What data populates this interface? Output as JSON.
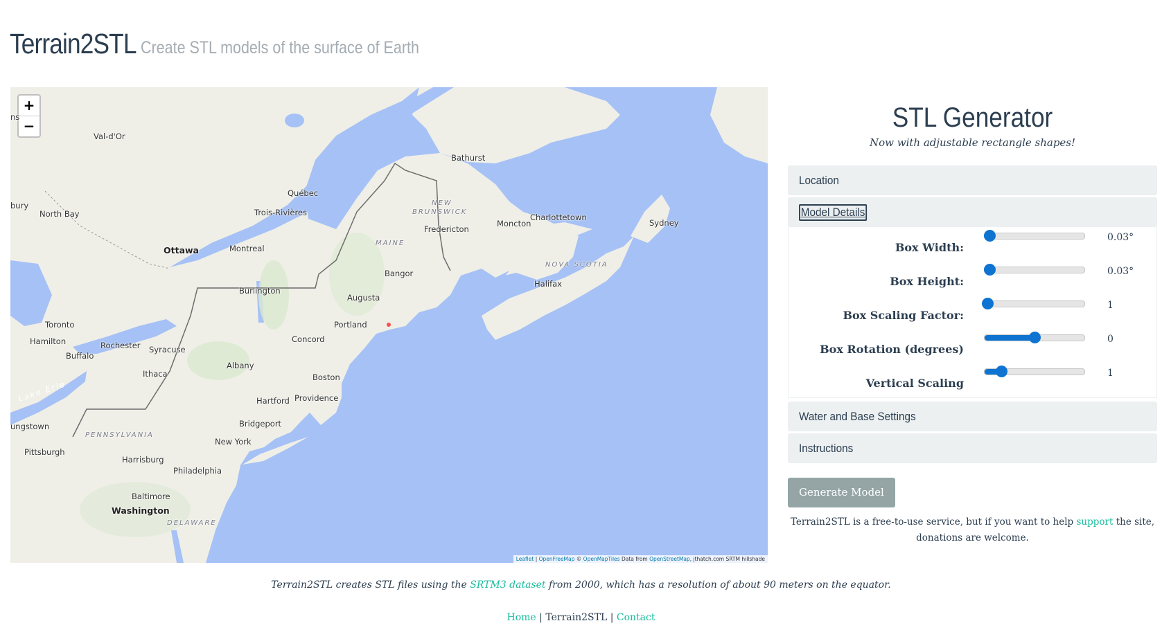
{
  "header": {
    "brand": "Terrain2STL",
    "tagline": "Create STL models of the surface of Earth"
  },
  "map": {
    "zoom_in": "+",
    "zoom_out": "−",
    "labels": [
      {
        "text": "Val-d'Or",
        "cls": ""
      },
      {
        "text": "Bathurst",
        "cls": ""
      },
      {
        "text": "Québec",
        "cls": ""
      },
      {
        "text": "bury",
        "cls": ""
      },
      {
        "text": "North Bay",
        "cls": ""
      },
      {
        "text": "Trois-Rivières",
        "cls": ""
      },
      {
        "text": "NEW",
        "cls": "region"
      },
      {
        "text": "BRUNSWICK",
        "cls": "region"
      },
      {
        "text": "Charlottetown",
        "cls": ""
      },
      {
        "text": "Sydney",
        "cls": ""
      },
      {
        "text": "Fredericton",
        "cls": ""
      },
      {
        "text": "Moncton",
        "cls": ""
      },
      {
        "text": "Ottawa",
        "cls": "big"
      },
      {
        "text": "Montreal",
        "cls": ""
      },
      {
        "text": "MAINE",
        "cls": "region"
      },
      {
        "text": "NOVA SCOTIA",
        "cls": "region"
      },
      {
        "text": "Bangor",
        "cls": ""
      },
      {
        "text": "Halifax",
        "cls": ""
      },
      {
        "text": "Burlington",
        "cls": ""
      },
      {
        "text": "Augusta",
        "cls": ""
      },
      {
        "text": "Toronto",
        "cls": ""
      },
      {
        "text": "Portland",
        "cls": ""
      },
      {
        "text": "Hamilton",
        "cls": ""
      },
      {
        "text": "Rochester",
        "cls": ""
      },
      {
        "text": "Syracuse",
        "cls": ""
      },
      {
        "text": "Concord",
        "cls": ""
      },
      {
        "text": "Buffalo",
        "cls": ""
      },
      {
        "text": "Albany",
        "cls": ""
      },
      {
        "text": "Ithaca",
        "cls": ""
      },
      {
        "text": "Boston",
        "cls": ""
      },
      {
        "text": "Lake Erie",
        "cls": "lake"
      },
      {
        "text": "Hartford",
        "cls": ""
      },
      {
        "text": "Providence",
        "cls": ""
      },
      {
        "text": "ungstown",
        "cls": ""
      },
      {
        "text": "Bridgeport",
        "cls": ""
      },
      {
        "text": "PENNSYLVANIA",
        "cls": "region"
      },
      {
        "text": "New York",
        "cls": ""
      },
      {
        "text": "Pittsburgh",
        "cls": ""
      },
      {
        "text": "Harrisburg",
        "cls": ""
      },
      {
        "text": "Philadelphia",
        "cls": ""
      },
      {
        "text": "Baltimore",
        "cls": ""
      },
      {
        "text": "Washington",
        "cls": "big"
      },
      {
        "text": "DELAWARE",
        "cls": "region"
      },
      {
        "text": "ns",
        "cls": ""
      }
    ],
    "attribution": {
      "leaflet": "Leaflet",
      "sep1": " | ",
      "openfreemap": "OpenFreeMap",
      "mid": " © ",
      "openmaptiles": "OpenMapTiles",
      "data_from": " Data from ",
      "osm": "OpenStreetMap",
      "tail": ", jthatch.com SRTM hillshade"
    }
  },
  "panel": {
    "title": "STL Generator",
    "subtitle": "Now with adjustable rectangle shapes!",
    "sections": {
      "location": "Location",
      "model_details": "Model Details",
      "water": "Water and Base Settings",
      "instructions": "Instructions"
    },
    "rows": [
      {
        "name": "Box Width:",
        "value": "0.03°",
        "level": 0.05
      },
      {
        "name": "Box Height:",
        "value": "0.03°",
        "level": 0.05
      },
      {
        "name": "Box Scaling Factor:",
        "value": "1",
        "level": 0.03
      },
      {
        "name": "Box Rotation (degrees)",
        "value": "0",
        "level": 0.5
      },
      {
        "name": "Vertical Scaling",
        "value": "1",
        "level": 0.17
      }
    ],
    "generate": "Generate Model",
    "donate_pre": "Terrain2STL is a free-to-use service, but if you want to help ",
    "donate_link": "support",
    "donate_post": " the site, donations are welcome."
  },
  "footer": {
    "desc_pre": "Terrain2STL creates STL files using the ",
    "desc_link": "SRTM3 dataset",
    "desc_post": " from 2000, which has a resolution of about 90 meters on the equator.",
    "home": "Home",
    "sep": " | ",
    "current": "Terrain2STL",
    "contact": "Contact"
  },
  "colors": {
    "water": "#a6c1f5",
    "land": "#efefe8",
    "accent": "#18bc9c",
    "slider": "#0f74d1"
  }
}
